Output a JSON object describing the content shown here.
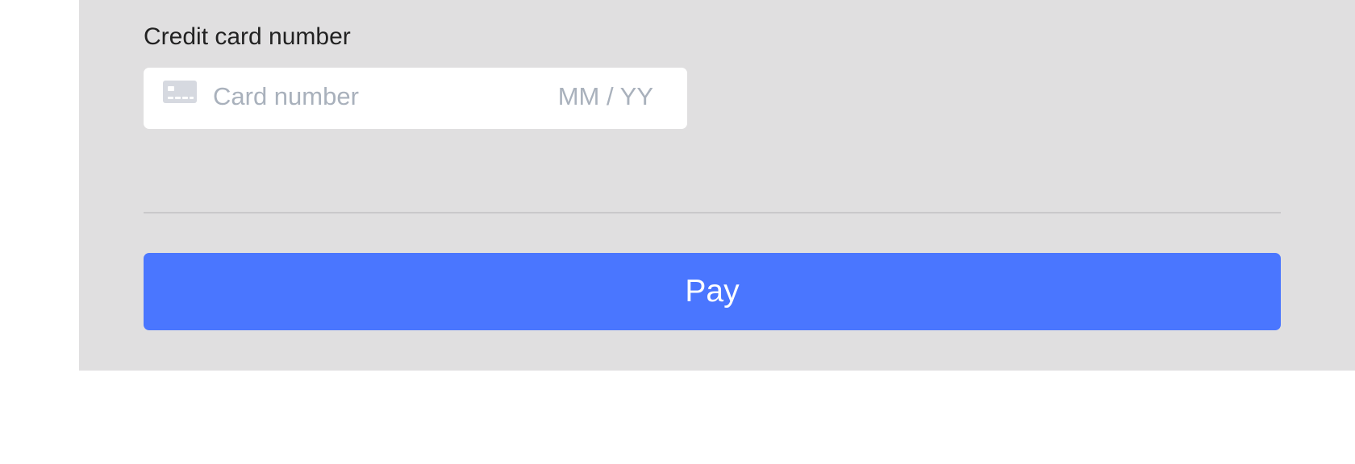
{
  "payment_form": {
    "card_field_label": "Credit card number",
    "card_number_placeholder": "Card number",
    "card_number_value": "",
    "expiry_placeholder": "MM / YY",
    "expiry_value": "",
    "card_icon": "credit-card-icon",
    "pay_button_label": "Pay"
  },
  "colors": {
    "panel_background": "#e0dfe0",
    "pay_button": "#4a76ff",
    "placeholder_text": "#a9b1bc"
  }
}
